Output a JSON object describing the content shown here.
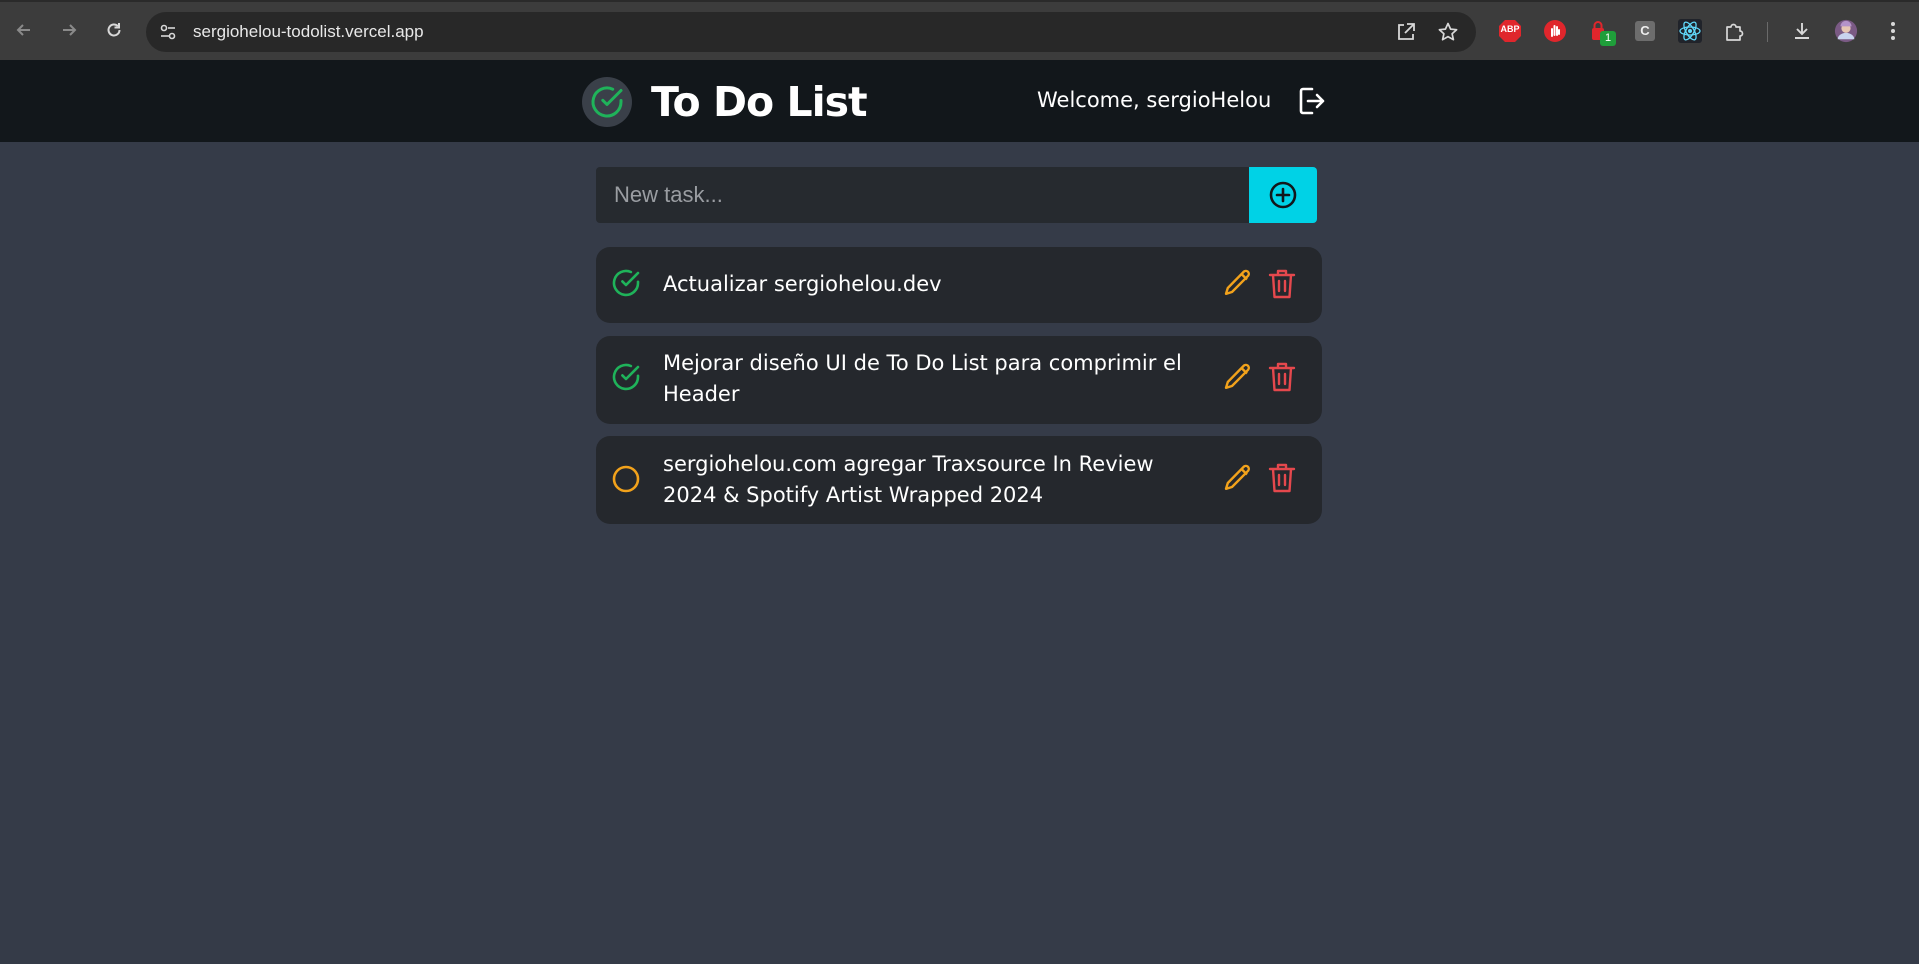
{
  "browser": {
    "url": "sergiohelou-todolist.vercel.app",
    "extensions": [
      "adblock-plus-icon",
      "stop-hand-icon",
      "lock-badge-icon",
      "c-extension-icon",
      "react-devtools-icon",
      "puzzle-icon"
    ],
    "abp_label": "ABP",
    "badge_count": "1",
    "c_label": "C"
  },
  "header": {
    "title": "To Do List",
    "welcome": "Welcome, sergioHelou"
  },
  "new_task": {
    "placeholder": "New task..."
  },
  "tasks": [
    {
      "text": "Actualizar sergiohelou.dev",
      "done": true
    },
    {
      "text": "Mejorar diseño UI de To Do List para comprimir el Header",
      "done": true
    },
    {
      "text": "sergiohelou.com agregar Traxsource In Review 2024 & Spotify Artist Wrapped 2024",
      "done": false
    }
  ],
  "colors": {
    "done": "#1fb35a",
    "pending": "#f2a21b",
    "edit": "#f2a21b",
    "delete": "#e5484d",
    "accent": "#00d2e6"
  }
}
